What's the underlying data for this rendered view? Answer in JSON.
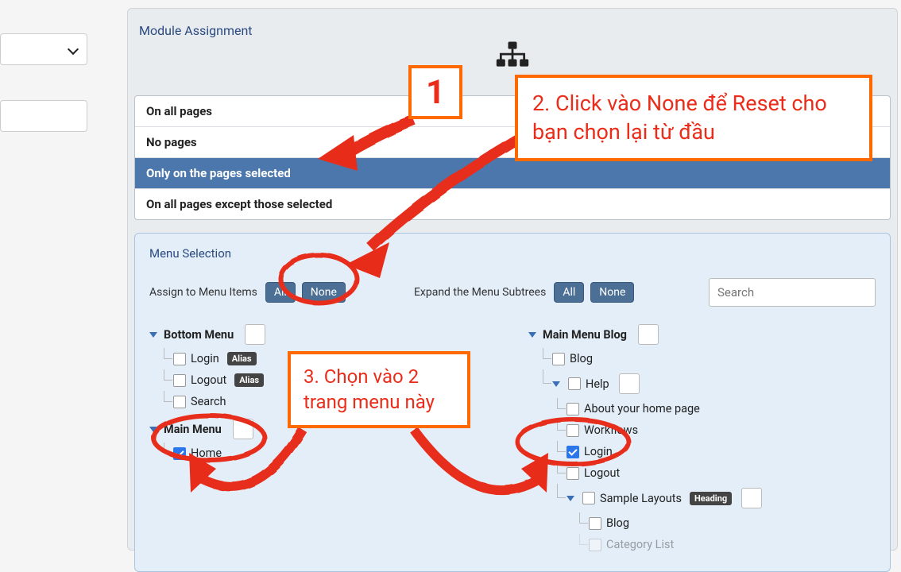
{
  "moduleAssignment": {
    "title": "Module Assignment",
    "options": [
      "On all pages",
      "No pages",
      "Only on the pages selected",
      "On all pages except those selected"
    ]
  },
  "menuSelection": {
    "title": "Menu Selection",
    "assignLabel": "Assign to Menu Items",
    "expandLabel": "Expand the Menu Subtrees",
    "btnAll": "All",
    "btnNone": "None",
    "searchPlaceholder": "Search"
  },
  "leftMenus": {
    "bottom": {
      "name": "Bottom Menu",
      "items": [
        {
          "label": "Login",
          "tag": "Alias",
          "checked": false
        },
        {
          "label": "Logout",
          "tag": "Alias",
          "checked": false
        },
        {
          "label": "Search",
          "checked": false
        }
      ]
    },
    "main": {
      "name": "Main Menu",
      "items": [
        {
          "label": "Home",
          "checked": true
        }
      ]
    }
  },
  "rightMenus": {
    "blog": {
      "name": "Main Menu Blog",
      "items": {
        "blog": "Blog",
        "help": "Help",
        "about": "About your home page",
        "workflows": "Workflows",
        "login": "Login",
        "logout": "Logout",
        "sample": "Sample Layouts",
        "sampleTag": "Heading",
        "sblog": "Blog",
        "catlist": "Category List"
      }
    }
  },
  "annotations": {
    "one": "1",
    "two": "2. Click vào None để Reset cho bạn chọn lại từ đầu",
    "three": "3. Chọn vào 2 trang menu này"
  }
}
